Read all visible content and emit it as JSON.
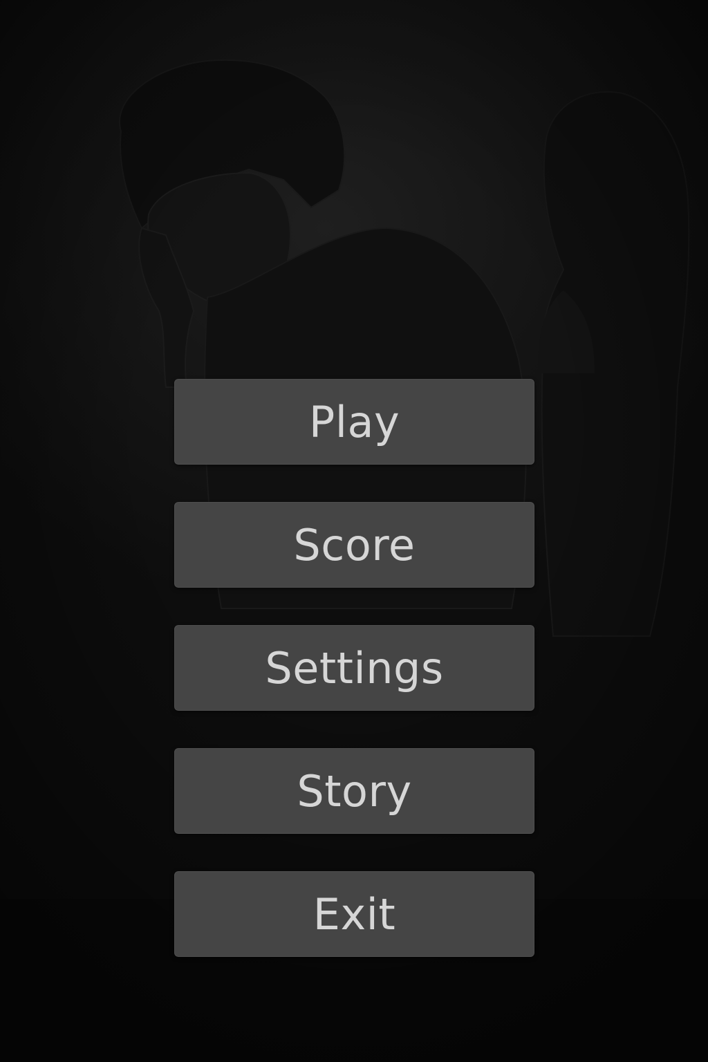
{
  "background": {
    "description_icon": "dark-sketch-couple-illustration",
    "colors": {
      "base": "#0b0b0b",
      "figure": "#111111",
      "button_bg": "#454545",
      "button_text": "#d6d6d6"
    }
  },
  "menu": {
    "items": [
      {
        "id": "play",
        "label": "Play"
      },
      {
        "id": "score",
        "label": "Score"
      },
      {
        "id": "settings",
        "label": "Settings"
      },
      {
        "id": "story",
        "label": "Story"
      },
      {
        "id": "exit",
        "label": "Exit"
      }
    ]
  }
}
